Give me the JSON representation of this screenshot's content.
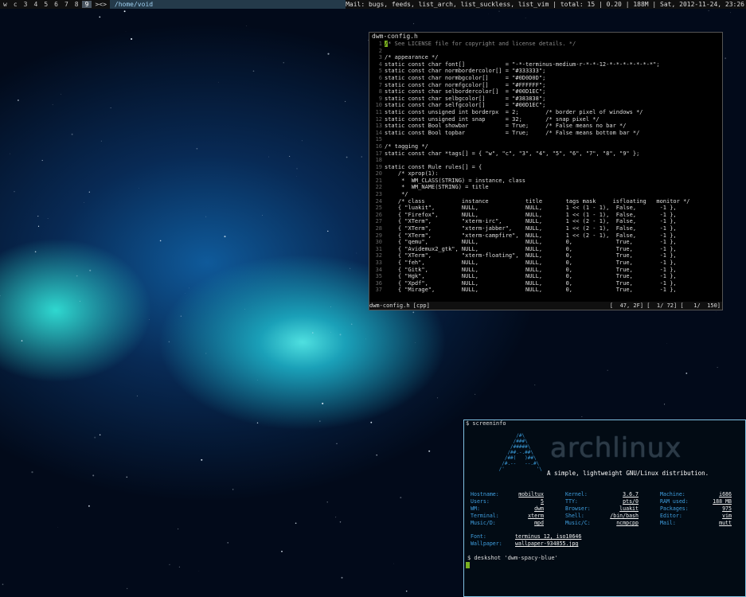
{
  "statusbar": {
    "tags": [
      "w",
      "c",
      "3",
      "4",
      "5",
      "6",
      "7",
      "8",
      "9"
    ],
    "layout": "><>",
    "window_title": "/home/void",
    "status": "Mail: bugs, feeds, list_arch, list_suckless, list_vim | total: 15 | 0.20 | 188M | Sat, 2012-11-24, 23:26"
  },
  "editor": {
    "title": "dwm-config.h",
    "lines": [
      "/* See LICENSE file for copyright and license details. */",
      "",
      "/* appearance */",
      "static const char font[]            = \"-*-terminus-medium-r-*-*-12-*-*-*-*-*-*-*\";",
      "static const char normbordercolor[] = \"#333333\";",
      "static const char normbgcolor[]     = \"#0D0D0D\";",
      "static const char normfgcolor[]     = \"#FFFFFF\";",
      "static const char selbordercolor[]  = \"#00D1EC\";",
      "static const char selbgcolor[]      = \"#383838\";",
      "static const char selfgcolor[]      = \"#00D1EC\";",
      "static const unsigned int borderpx  = 2;        /* border pixel of windows */",
      "static const unsigned int snap      = 32;       /* snap pixel */",
      "static const Bool showbar           = True;     /* False means no bar */",
      "static const Bool topbar            = True;     /* False means bottom bar */",
      "",
      "/* tagging */",
      "static const char *tags[] = { \"w\", \"c\", \"3\", \"4\", \"5\", \"6\", \"7\", \"8\", \"9\" };",
      "",
      "static const Rule rules[] = {",
      "    /* xprop(1):",
      "     *  WM_CLASS(STRING) = instance, class",
      "     *  WM_NAME(STRING) = title",
      "     */",
      "    /* class           instance           title       tags mask     isfloating   monitor */",
      "    { \"luakit\",        NULL,              NULL,       1 << (1 - 1),  False,       -1 },",
      "    { \"Firefox\",       NULL,              NULL,       1 << (1 - 1),  False,       -1 },",
      "    { \"XTerm\",         \"xterm-irc\",       NULL,       1 << (2 - 1),  False,       -1 },",
      "    { \"XTerm\",         \"xterm-jabber\",    NULL,       1 << (2 - 1),  False,       -1 },",
      "    { \"XTerm\",         \"xterm-campfire\",  NULL,       1 << (2 - 1),  False,       -1 },",
      "    { \"qemu\",          NULL,              NULL,       0,             True,        -1 },",
      "    { \"Avidemux2_gtk\", NULL,              NULL,       0,             True,        -1 },",
      "    { \"XTerm\",         \"xterm-floating\",  NULL,       0,             True,        -1 },",
      "    { \"feh\",           NULL,              NULL,       0,             True,        -1 },",
      "    { \"Gitk\",          NULL,              NULL,       0,             True,        -1 },",
      "    { \"Hgk\",           NULL,              NULL,       0,             True,        -1 },",
      "    { \"Xpdf\",          NULL,              NULL,       0,             True,        -1 },",
      "    { \"Mirage\",        NULL,              NULL,       0,             True,        -1 },"
    ],
    "status_left": "dwm-config.h [cpp]",
    "status_right": "[  47, 2F] [  1/ 72] [   1/  150]"
  },
  "terminal": {
    "cmd1": "$ screeninfo",
    "ascii": "       /#\\\n      /###\\\n     /#####\\\n    /##.-.##\\\n   /##(   )##\\\n  /#.--   --.#\\\n /'           '\\",
    "logo": "archlinux",
    "tagline": "A simple, lightweight GNU/Linux distribution.",
    "col1": [
      [
        "Hostname:",
        "mobiltux"
      ],
      [
        "Users:",
        "5"
      ],
      [
        "WM:",
        "dwm"
      ],
      [
        "Terminal:",
        "xterm"
      ],
      [
        "Music/D:",
        "mpd"
      ]
    ],
    "col2": [
      [
        "Kernel:",
        "3.6.7"
      ],
      [
        "TTY:",
        "pts/0"
      ],
      [
        "Browser:",
        "luakit"
      ],
      [
        "Shell:",
        "/bin/bash"
      ],
      [
        "Music/C:",
        "ncmpcpp"
      ]
    ],
    "col3": [
      [
        "Machine:",
        "i686"
      ],
      [
        "RAM used:",
        "188 MB"
      ],
      [
        "Packages:",
        "975"
      ],
      [
        "Editor:",
        "vim"
      ],
      [
        "Mail:",
        "mutt"
      ]
    ],
    "font_label": "Font:",
    "font_value": "terminus 12, iso10646",
    "wallpaper_label": "Wallpaper:",
    "wallpaper_value": "wallpaper-934855.jpg",
    "cmd2": "$ deskshot 'dwm-spacy-blue'"
  }
}
